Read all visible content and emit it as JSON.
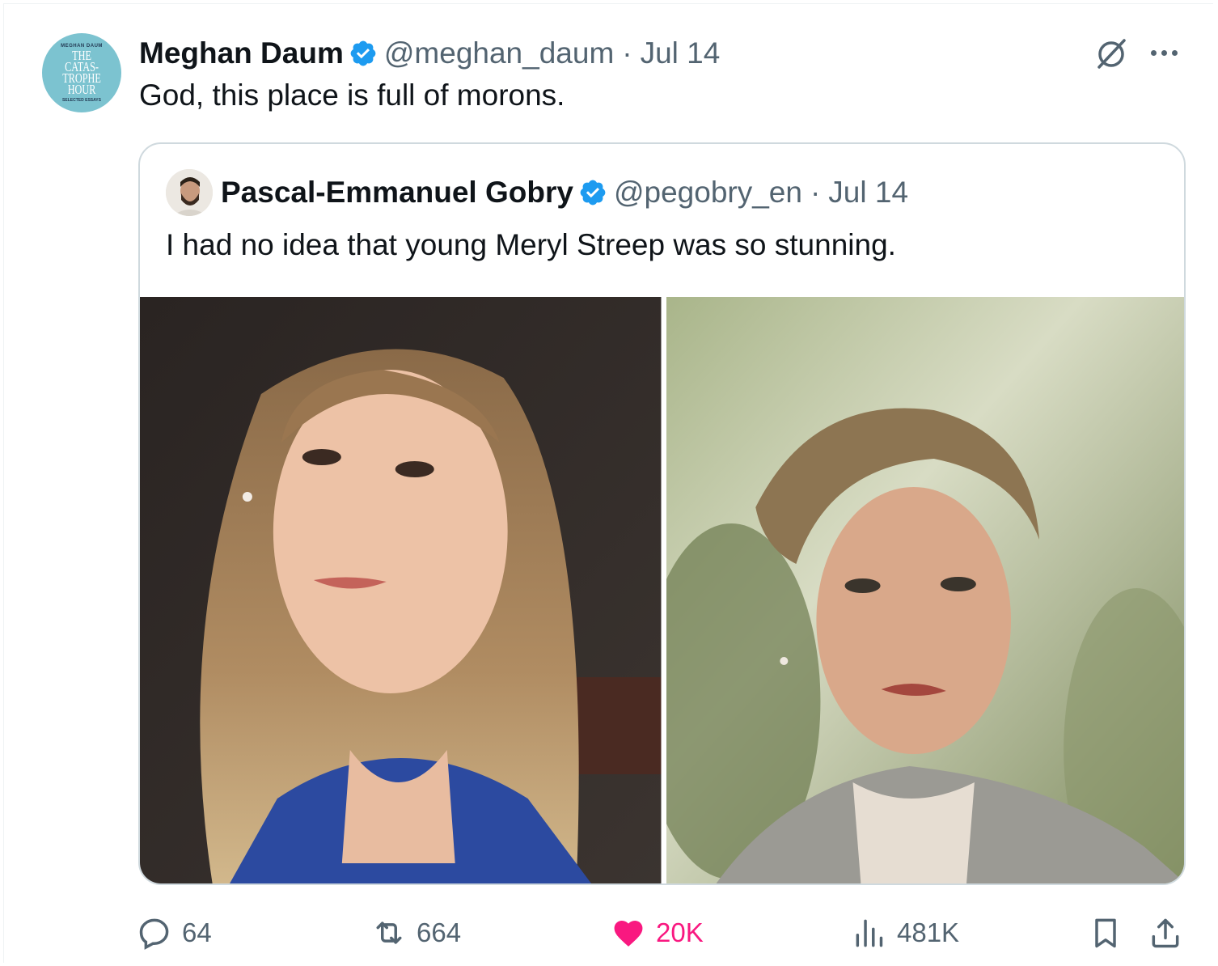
{
  "tweet": {
    "avatar": {
      "top_text": "MEGHAN DAUM",
      "title": "THE\nCATAS-\nTROPHE\nHOUR",
      "bottom_text": "SELECTED ESSAYS"
    },
    "author_name": "Meghan Daum",
    "handle": "@meghan_daum",
    "separator": "·",
    "date": "Jul 14",
    "text": "God, this place is full of morons."
  },
  "quote": {
    "author_name": "Pascal-Emmanuel Gobry",
    "handle": "@pegobry_en",
    "separator": "·",
    "date": "Jul 14",
    "text": "I had no idea that young Meryl Streep was so stunning."
  },
  "actions": {
    "replies": "64",
    "reposts": "664",
    "likes": "20K",
    "views": "481K"
  },
  "colors": {
    "verified": "#1d9bf0",
    "secondary_text": "#536471",
    "like": "#f91880",
    "border": "#cfd9de"
  },
  "icons": [
    "verified-badge-icon",
    "grok-icon",
    "more-icon",
    "reply-icon",
    "repost-icon",
    "like-icon",
    "views-icon",
    "bookmark-icon",
    "share-icon"
  ]
}
